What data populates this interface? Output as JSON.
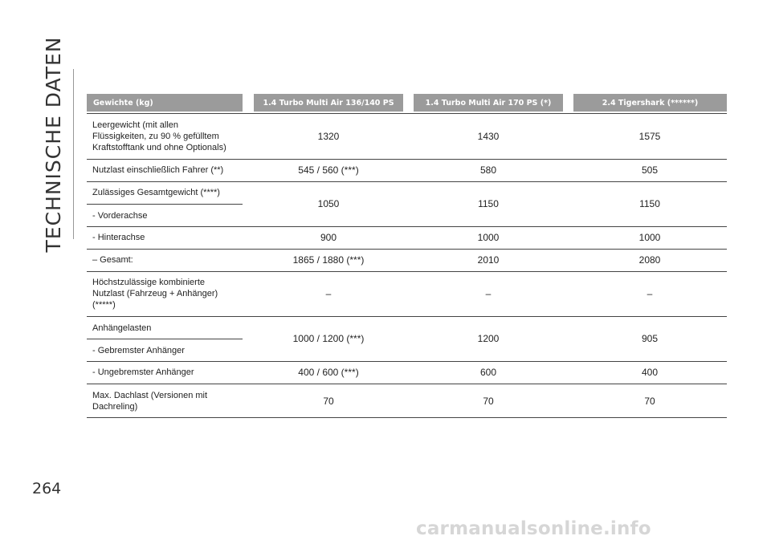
{
  "section_title": "TECHNISCHE DATEN",
  "page_number": "264",
  "watermark": "carmanualsonline.info",
  "table": {
    "headers": [
      "Gewichte (kg)",
      "1.4 Turbo Multi Air 136/140 PS",
      "1.4 Turbo Multi Air 170 PS (*)",
      "2.4 Tigershark (******)"
    ],
    "rows": [
      {
        "label": "Leergewicht (mit allen\nFlüssigkeiten, zu 90 % gefülltem\nKraftstofftank und ohne Optionals)",
        "values": [
          "1320",
          "1430",
          "1575"
        ]
      },
      {
        "label": "Nutzlast einschließlich Fahrer (**)",
        "values": [
          "545 / 560 (***)",
          "580",
          "505"
        ]
      },
      {
        "label": "Zulässiges Gesamtgewicht (****)",
        "sublabel": "- Vorderachse",
        "values": [
          "1050",
          "1150",
          "1150"
        ]
      },
      {
        "label": "- Hinterachse",
        "values": [
          "900",
          "1000",
          "1000"
        ]
      },
      {
        "label": "– Gesamt:",
        "values": [
          "1865 / 1880 (***)",
          "2010",
          "2080"
        ]
      },
      {
        "label": "Höchstzulässige kombinierte\nNutzlast (Fahrzeug + Anhänger)\n(*****)",
        "values": [
          "–",
          "–",
          "–"
        ]
      },
      {
        "label": "Anhängelasten",
        "sublabel": "- Gebremster Anhänger",
        "values": [
          "1000 / 1200 (***)",
          "1200",
          "905"
        ]
      },
      {
        "label": "- Ungebremster Anhänger",
        "values": [
          "400 / 600 (***)",
          "600",
          "400"
        ]
      },
      {
        "label": "Max. Dachlast (Versionen mit\nDachreling)",
        "values": [
          "70",
          "70",
          "70"
        ]
      }
    ]
  }
}
